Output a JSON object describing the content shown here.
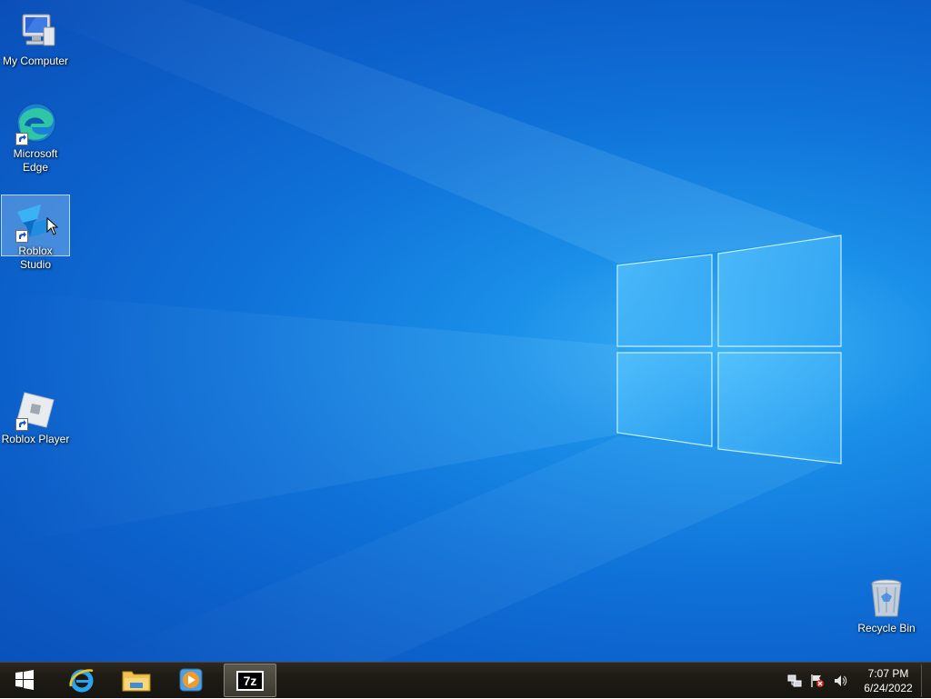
{
  "desktop": {
    "icons": [
      {
        "label": "My Computer"
      },
      {
        "label": "Microsoft Edge"
      },
      {
        "label": "Roblox Studio"
      },
      {
        "label": "Roblox Player"
      },
      {
        "label": "Recycle Bin"
      }
    ]
  },
  "taskbar": {
    "start_icon": "windows-logo-icon",
    "pinned": [
      {
        "name": "internet-explorer",
        "icon": "internet-explorer-icon"
      },
      {
        "name": "file-explorer",
        "icon": "folder-icon"
      },
      {
        "name": "media-player",
        "icon": "media-player-icon"
      },
      {
        "name": "7-zip",
        "icon": "7zip-icon",
        "text": "7z",
        "active": true
      }
    ],
    "tray": {
      "icons": [
        "network-icon",
        "action-center-flag-icon",
        "volume-icon"
      ],
      "time": "7:07 PM",
      "date": "6/24/2022"
    }
  },
  "colors": {
    "wallpaper_blue": "#0f72d8",
    "taskbar": "#1f1c16",
    "text": "#ffffff"
  }
}
